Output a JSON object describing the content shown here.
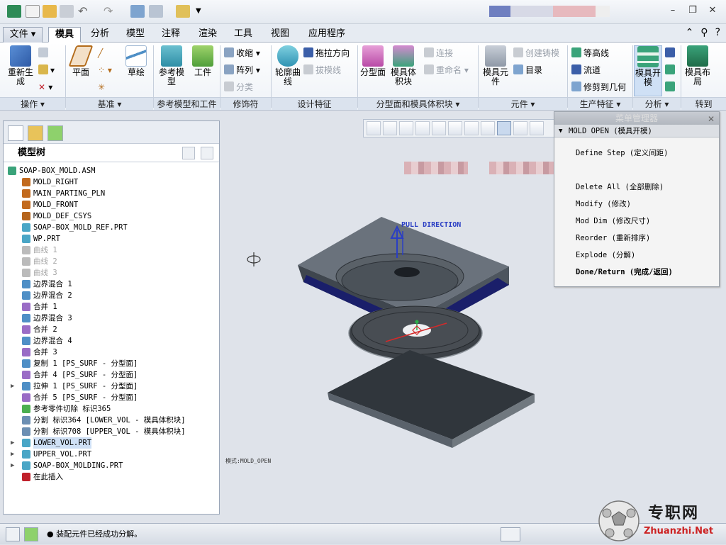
{
  "tabs": {
    "file": "文件",
    "items": [
      "模具",
      "分析",
      "模型",
      "注释",
      "渲染",
      "工具",
      "视图",
      "应用程序"
    ]
  },
  "ribbon": {
    "groups": [
      "操作",
      "基准",
      "参考模型和工件",
      "修饰符",
      "设计特征",
      "分型面和模具体积块",
      "元件",
      "生产特征",
      "分析",
      "转到"
    ],
    "regen": "重新生成",
    "plane": "平面",
    "sketch": "草绘",
    "ref_model": "参考模型",
    "workpiece": "工件",
    "shrink": "收缩",
    "pattern": "阵列",
    "classify": "分类",
    "silhouette": "轮廓曲线",
    "drag_dir": "拖拉方向",
    "draft_line": "拔模线",
    "parting_surface": "分型面",
    "mold_volume": "模具体积块",
    "connect": "连接",
    "rename": "重命名",
    "mold_component": "模具元件",
    "create_casting": "创建铸模",
    "catalog": "目录",
    "contour": "等高线",
    "flow": "流道",
    "trim_geom": "修剪到几何",
    "mold_open": "模具开模",
    "mold_layout": "模具布局"
  },
  "model_tree": {
    "title": "模型树",
    "nodes": [
      {
        "label": "SOAP-BOX_MOLD.ASM",
        "indent": 0,
        "icon": "assembly-icon",
        "color": "#3aa37a"
      },
      {
        "label": "MOLD_RIGHT",
        "indent": 1,
        "icon": "datum-plane-icon",
        "color": "#c26a1e"
      },
      {
        "label": "MAIN_PARTING_PLN",
        "indent": 1,
        "icon": "datum-plane-icon",
        "color": "#c26a1e"
      },
      {
        "label": "MOLD_FRONT",
        "indent": 1,
        "icon": "datum-plane-icon",
        "color": "#c26a1e"
      },
      {
        "label": "MOLD_DEF_CSYS",
        "indent": 1,
        "icon": "csys-icon",
        "color": "#b5651d"
      },
      {
        "label": "SOAP-BOX_MOLD_REF.PRT",
        "indent": 1,
        "icon": "part-icon",
        "color": "#4aa6c6"
      },
      {
        "label": "WP.PRT",
        "indent": 1,
        "icon": "part-icon",
        "color": "#4aa6c6"
      },
      {
        "label": "曲线 1",
        "indent": 1,
        "icon": "curve-icon",
        "color": "#bbbbbb",
        "gray": true
      },
      {
        "label": "曲线 2",
        "indent": 1,
        "icon": "curve-icon",
        "color": "#bbbbbb",
        "gray": true
      },
      {
        "label": "曲线 3",
        "indent": 1,
        "icon": "curve-icon",
        "color": "#bbbbbb",
        "gray": true
      },
      {
        "label": "边界混合 1",
        "indent": 1,
        "icon": "blend-icon",
        "color": "#4f8fc6"
      },
      {
        "label": "边界混合 2",
        "indent": 1,
        "icon": "blend-icon",
        "color": "#4f8fc6"
      },
      {
        "label": "合并 1",
        "indent": 1,
        "icon": "merge-icon",
        "color": "#9a6cc6"
      },
      {
        "label": "边界混合 3",
        "indent": 1,
        "icon": "blend-icon",
        "color": "#4f8fc6"
      },
      {
        "label": "合并 2",
        "indent": 1,
        "icon": "merge-icon",
        "color": "#9a6cc6"
      },
      {
        "label": "边界混合 4",
        "indent": 1,
        "icon": "blend-icon",
        "color": "#4f8fc6"
      },
      {
        "label": "合并 3",
        "indent": 1,
        "icon": "merge-icon",
        "color": "#9a6cc6"
      },
      {
        "label": "复制 1 [PS_SURF - 分型面]",
        "indent": 1,
        "icon": "copy-icon",
        "color": "#4f8fc6"
      },
      {
        "label": "合并 4 [PS_SURF - 分型面]",
        "indent": 1,
        "icon": "merge-icon",
        "color": "#9a6cc6"
      },
      {
        "label": "拉伸 1 [PS_SURF - 分型面]",
        "indent": 1,
        "icon": "extrude-icon",
        "color": "#4f8fc6",
        "arrow": true
      },
      {
        "label": "合并 5 [PS_SURF - 分型面]",
        "indent": 1,
        "icon": "merge-icon",
        "color": "#9a6cc6"
      },
      {
        "label": "参考零件切除 标识365",
        "indent": 1,
        "icon": "cutout-icon",
        "color": "#4caf50"
      },
      {
        "label": "分割 标识364 [LOWER_VOL - 模具体积块]",
        "indent": 1,
        "icon": "split-icon",
        "color": "#6c8fb3"
      },
      {
        "label": "分割 标识708 [UPPER_VOL - 模具体积块]",
        "indent": 1,
        "icon": "split-icon",
        "color": "#6c8fb3"
      },
      {
        "label": "LOWER_VOL.PRT",
        "indent": 1,
        "icon": "part-icon",
        "color": "#4aa6c6",
        "arrow": true,
        "selected": true
      },
      {
        "label": "UPPER_VOL.PRT",
        "indent": 1,
        "icon": "part-icon",
        "color": "#4aa6c6",
        "arrow": true
      },
      {
        "label": "SOAP-BOX_MOLDING.PRT",
        "indent": 1,
        "icon": "part-icon",
        "color": "#4aa6c6",
        "arrow": true
      },
      {
        "label": "在此插入",
        "indent": 1,
        "icon": "insert-here-icon",
        "color": "#c0202a"
      }
    ]
  },
  "graphics": {
    "pull_direction": "PULL DIRECTION",
    "mode_text": "模式:MOLD_OPEN"
  },
  "menu_manager": {
    "title": "菜单管理器",
    "header": "MOLD OPEN (模具开模)",
    "items": [
      "Define Step (定义间距)",
      "Delete All (全部删除)",
      "Modify (修改)",
      "Mod Dim (修改尺寸)",
      "Reorder (重新排序)",
      "Explode (分解)",
      "Done/Return (完成/返回)"
    ]
  },
  "status": {
    "message": "装配元件已经成功分解。"
  },
  "watermark": {
    "cn": "专职网",
    "en": "Zhuanzhi.Net"
  },
  "colors": {
    "accent": "#3b5ea8",
    "plate_top": "#5e6670",
    "plate_dark": "#2f353c",
    "disc": "#4a4f55",
    "pull_arrow": "#2a3ec4"
  }
}
